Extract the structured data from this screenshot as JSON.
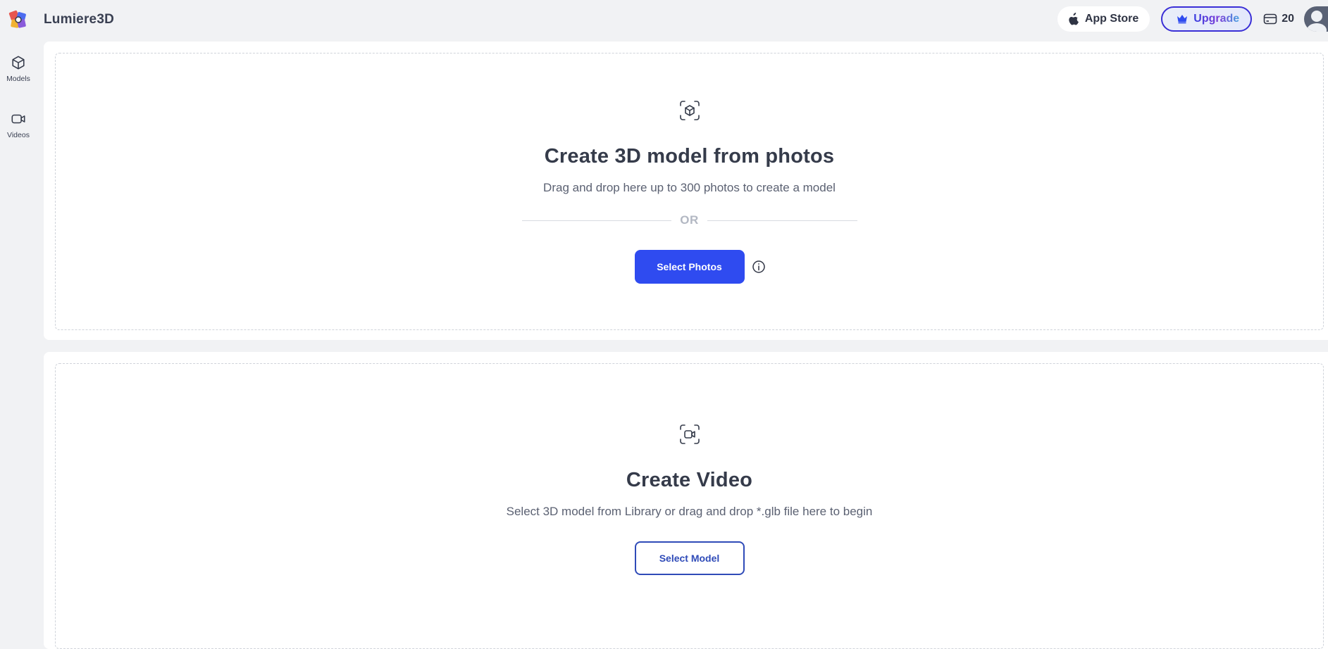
{
  "app": {
    "name": "Lumiere3D"
  },
  "header": {
    "app_store_label": "App Store",
    "upgrade_label": "Upgrade",
    "credits_count": "20"
  },
  "sidebar": {
    "items": [
      {
        "label": "Models",
        "icon": "cube-icon"
      },
      {
        "label": "Videos",
        "icon": "video-camera-icon"
      }
    ]
  },
  "photos_section": {
    "title": "Create 3D model from photos",
    "subtitle": "Drag and drop here up to 300 photos to create a model",
    "divider_text": "OR",
    "button_label": "Select Photos"
  },
  "video_section": {
    "title": "Create Video",
    "subtitle": "Select 3D model from Library or drag and drop *.glb file here to begin",
    "button_label": "Select Model"
  },
  "colors": {
    "primary": "#2f4bf0",
    "upgrade_border": "#3a2fd6",
    "background": "#f1f2f4"
  }
}
